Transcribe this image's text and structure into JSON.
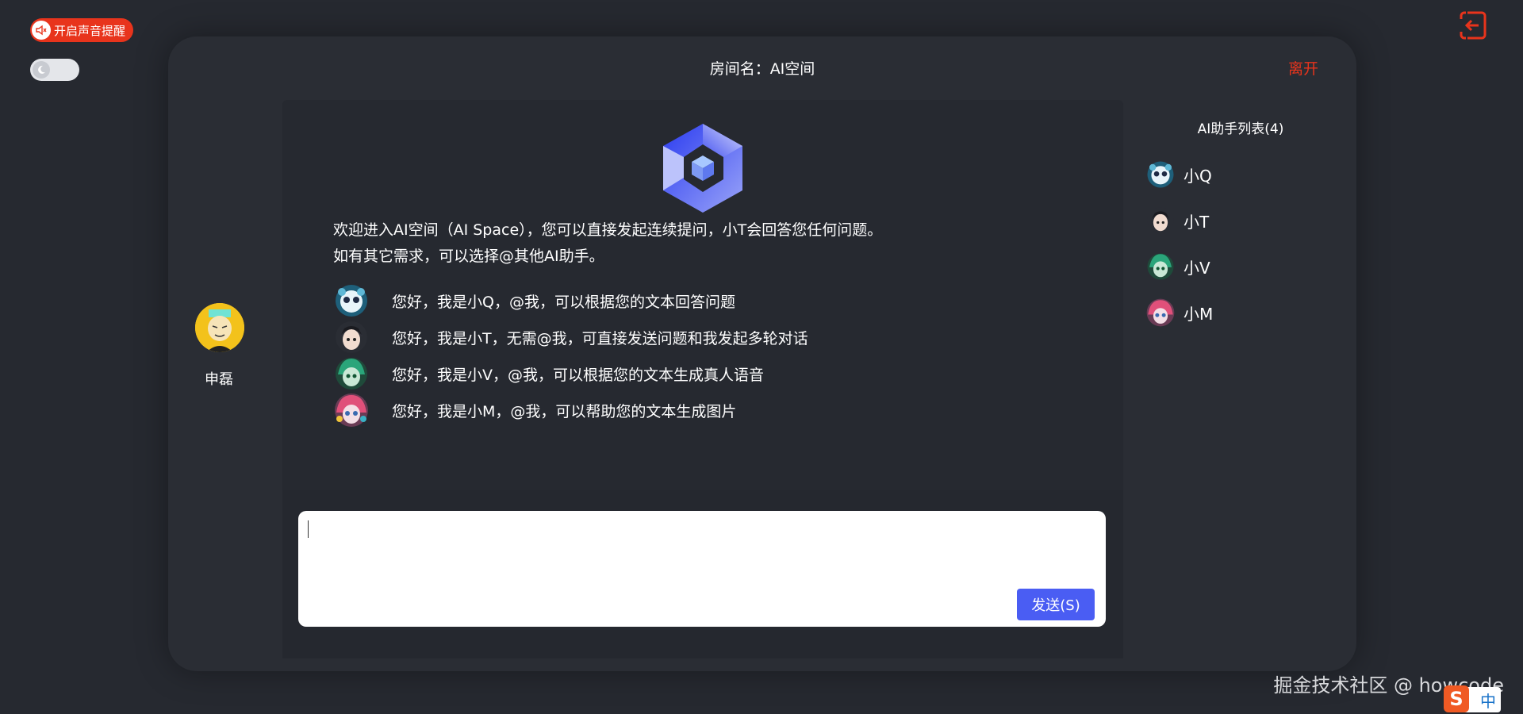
{
  "sound": {
    "label": "开启声音提醒"
  },
  "room": {
    "title": "房间名：AI空间",
    "leave_label": "离开"
  },
  "user": {
    "name": "申磊"
  },
  "welcome": {
    "line1": "欢迎进入AI空间（AI Space），您可以直接发起连续提问，小T会回答您任何问题。",
    "line2": "如有其它需求，可以选择@其他AI助手。"
  },
  "bots": [
    {
      "name": "小Q",
      "intro": "您好，我是小Q，@我，可以根据您的文本回答问题",
      "color": "#5fb8d6"
    },
    {
      "name": "小T",
      "intro": "您好，我是小T，无需@我，可直接发送问题和我发起多轮对话",
      "color": "#3b3f48"
    },
    {
      "name": "小V",
      "intro": "您好，我是小V，@我，可以根据您的文本生成真人语音",
      "color": "#2aa57a"
    },
    {
      "name": "小M",
      "intro": "您好，我是小M，@我，可以帮助您的文本生成图片",
      "color": "#e0507a"
    }
  ],
  "ai_list": {
    "title": "AI助手列表(4)"
  },
  "input": {
    "send_label": "发送(S)"
  },
  "watermark": "掘金技术社区 @ howcode",
  "ime": {
    "label": "中",
    "s": "S"
  },
  "colors": {
    "accent": "#e8341c",
    "send": "#4a5df3",
    "bg": "#262930",
    "panel": "#2a2d34"
  }
}
